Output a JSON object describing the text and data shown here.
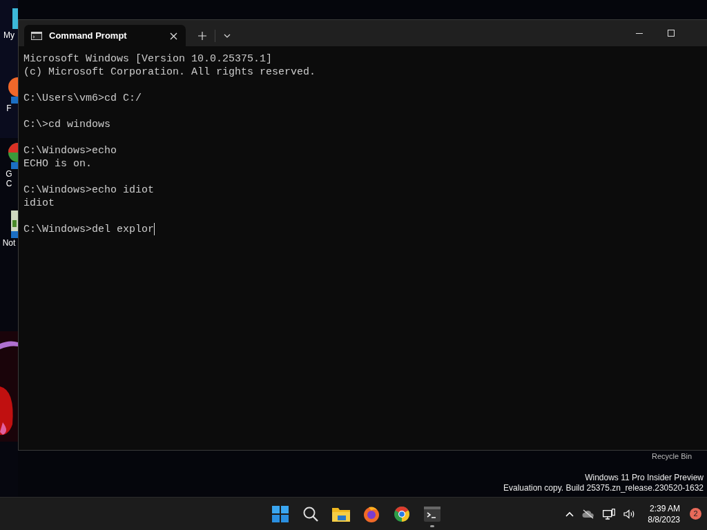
{
  "desktop": {
    "icons": [
      {
        "kind": "computer",
        "lines": [
          "My"
        ]
      },
      {
        "kind": "firefox",
        "lines": [
          "F"
        ]
      },
      {
        "kind": "chrome",
        "lines": [
          "G",
          "C"
        ]
      },
      {
        "kind": "notepad",
        "lines": [
          "Not"
        ]
      }
    ],
    "recycle_bin": {
      "label": "Recycle Bin"
    },
    "watermark": [
      "Windows 11 Pro Insider Preview",
      "Evaluation copy. Build 25375.zn_release.230520-1632"
    ]
  },
  "window": {
    "tabs": [
      {
        "title": "Command Prompt",
        "selected": true
      }
    ],
    "blocks": [
      [
        "Microsoft Windows [Version 10.0.25375.1]",
        "(c) Microsoft Corporation. All rights reserved."
      ],
      [
        "C:\\Users\\vm6>cd C:/"
      ],
      [
        "C:\\>cd windows"
      ],
      [
        "C:\\Windows>echo",
        "ECHO is on."
      ],
      [
        "C:\\Windows>echo idiot",
        "idiot"
      ],
      [
        "C:\\Windows>del explor"
      ]
    ],
    "cursor_visible": true
  },
  "taskbar": {
    "apps": [
      {
        "kind": "start",
        "running": false
      },
      {
        "kind": "search",
        "running": false
      },
      {
        "kind": "explorer",
        "running": false
      },
      {
        "kind": "firefox",
        "running": false
      },
      {
        "kind": "chrome",
        "running": false
      },
      {
        "kind": "terminal",
        "running": true
      }
    ],
    "tray": {
      "time": "2:39 AM",
      "date": "8/8/2023",
      "notifications": "2"
    }
  }
}
